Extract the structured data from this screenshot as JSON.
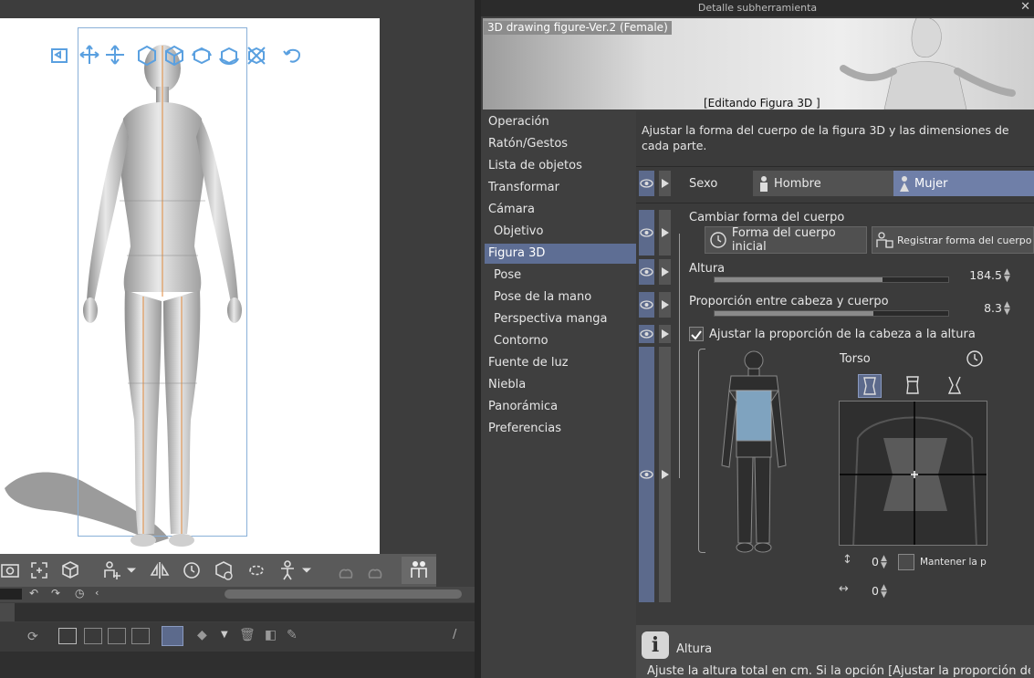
{
  "panel": {
    "title": "Detalle subherramienta",
    "close": "✕",
    "preview_label": "3D drawing figure-Ver.2 (Female)",
    "preview_status": "[Editando Figura 3D ]"
  },
  "categories": [
    {
      "label": "Operación",
      "indent": false
    },
    {
      "label": "Ratón/Gestos",
      "indent": false
    },
    {
      "label": "Lista de objetos",
      "indent": false
    },
    {
      "label": "Transformar",
      "indent": false
    },
    {
      "label": "Cámara",
      "indent": false
    },
    {
      "label": "Objetivo",
      "indent": true
    },
    {
      "label": "Figura 3D",
      "indent": false,
      "selected": true
    },
    {
      "label": "Pose",
      "indent": true
    },
    {
      "label": "Pose de la mano",
      "indent": true
    },
    {
      "label": "Perspectiva manga",
      "indent": true
    },
    {
      "label": "Contorno",
      "indent": true
    },
    {
      "label": "Fuente de luz",
      "indent": false
    },
    {
      "label": "Niebla",
      "indent": false
    },
    {
      "label": "Panorámica",
      "indent": false
    },
    {
      "label": "Preferencias",
      "indent": false
    }
  ],
  "settings": {
    "description": "Ajustar la forma del cuerpo de la figura 3D y las dimensiones de cada parte.",
    "sexo_label": "Sexo",
    "sexo_options": [
      "Hombre",
      "Mujer"
    ],
    "sexo_selected": "Mujer",
    "body_shape_label": "Cambiar forma del cuerpo",
    "initial_shape_button": "Forma del cuerpo inicial",
    "register_shape_button": "Registrar forma del cuerpo como",
    "height_label": "Altura",
    "height_value": "184.5",
    "height_fill": 0.72,
    "proportion_label": "Proporción entre cabeza y cuerpo",
    "proportion_value": "8.3",
    "proportion_fill": 0.68,
    "adjust_checkbox_label": "Ajustar la proporción de la cabeza a la altura",
    "adjust_checked": true,
    "part_label": "Torso",
    "offset_y": "0",
    "offset_x": "0",
    "keep_prop_label": "Mantener la prop",
    "info_title": "Altura",
    "info_text": "Ajuste la altura total en cm. Si la opción [Ajustar la proporción de la"
  },
  "colors": {
    "accent": "#6f7fa8",
    "selected_row": "#5e6e94",
    "gizmo_blue": "#5aa0e0"
  }
}
